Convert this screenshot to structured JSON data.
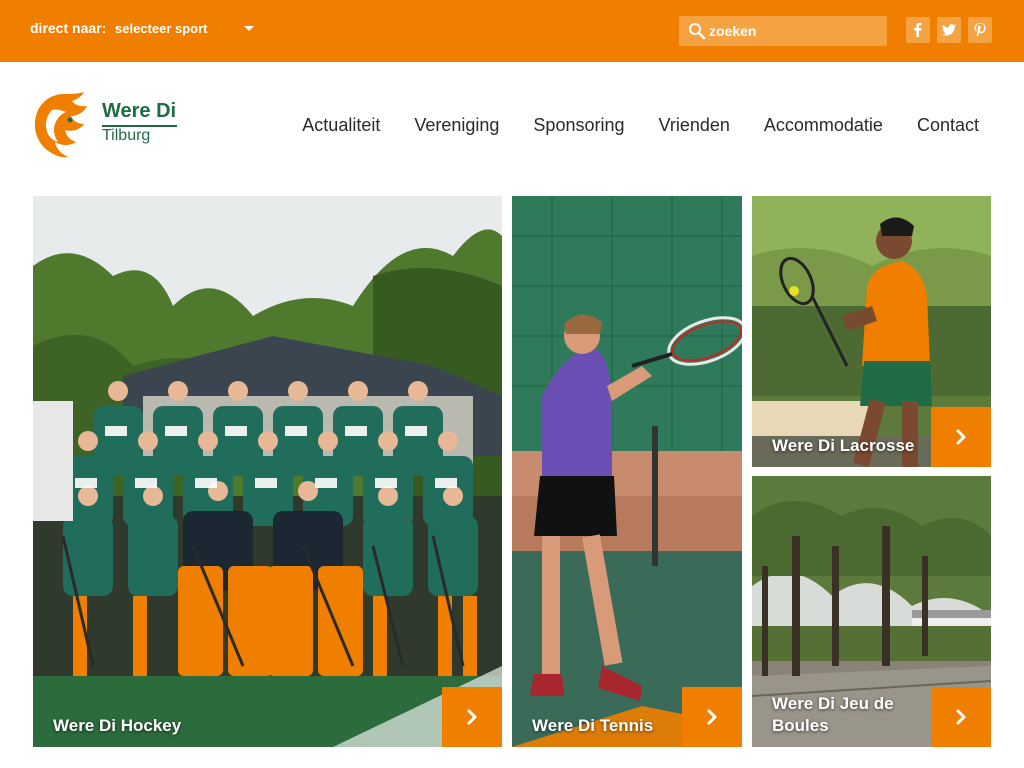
{
  "topbar": {
    "direct_label": "direct naar:",
    "sport_select_value": "selecteer sport",
    "search_placeholder": "zoeken"
  },
  "logo": {
    "name_line1": "Were Di",
    "name_line2": "Tilburg"
  },
  "nav": {
    "items": [
      "Actualiteit",
      "Vereniging",
      "Sponsoring",
      "Vrienden",
      "Accommodatie",
      "Contact"
    ]
  },
  "tiles": {
    "hockey": "Were Di Hockey",
    "tennis": "Were Di Tennis",
    "lacrosse": "Were Di Lacrosse",
    "jeu_de_boules_line1": "Were Di Jeu de",
    "jeu_de_boules_line2": "Boules"
  },
  "colors": {
    "brand_orange": "#f07f00",
    "brand_green": "#1e6b45"
  },
  "icons": [
    "search-icon",
    "facebook-icon",
    "twitter-icon",
    "pinterest-icon",
    "lion-logo-icon",
    "chevron-right-icon"
  ]
}
